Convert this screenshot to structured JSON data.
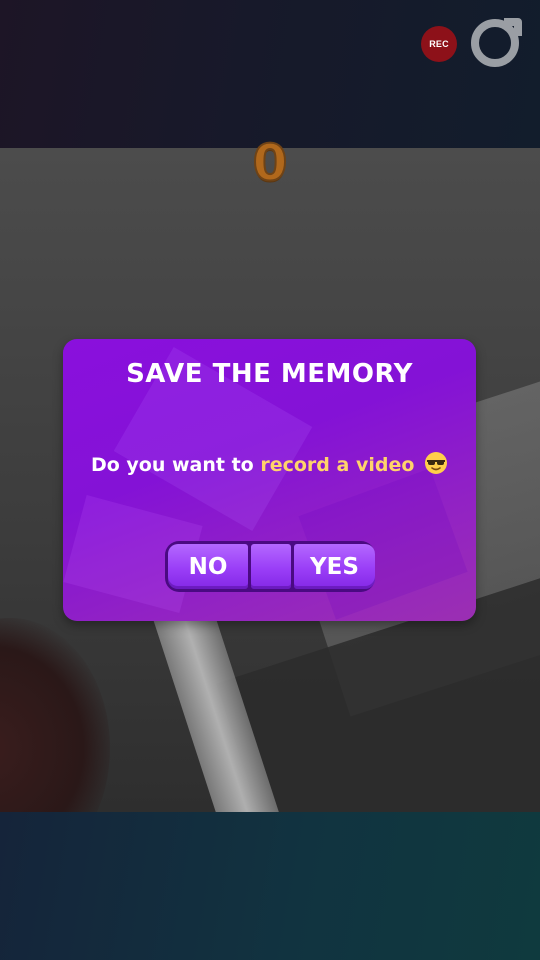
{
  "header": {
    "rec_label": "REC",
    "rec_color": "#8d1119",
    "menu_icon": "ring-icon"
  },
  "game": {
    "score": "0",
    "score_color": "#b0681c"
  },
  "dialog": {
    "title": "SAVE THE MEMORY",
    "message_prefix": "Do you want to",
    "message_highlight": "record a video",
    "emoji_icon": "sunglasses-emoji-icon",
    "no_label": "NO",
    "yes_label": "YES",
    "accent_color": "#8a10dd",
    "highlight_color": "#ffd36b"
  }
}
